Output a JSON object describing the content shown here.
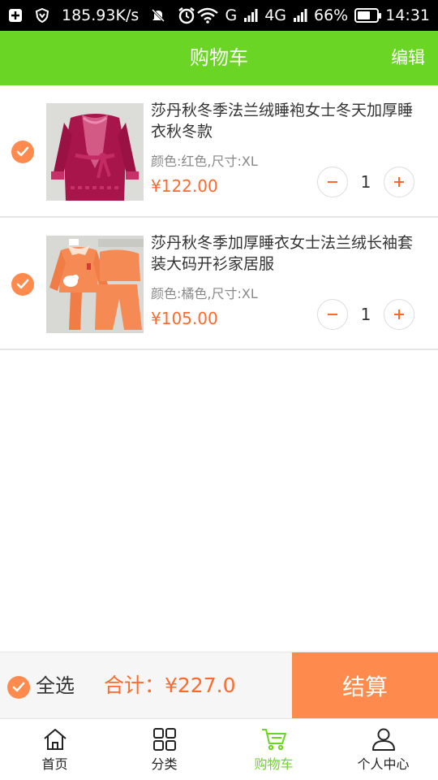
{
  "status_bar": {
    "net_speed": "185.93K/s",
    "network": "4G",
    "sim_label": "G",
    "battery_pct": "66%",
    "battery_level": 0.66,
    "time": "14:31"
  },
  "header": {
    "title": "购物车",
    "edit_label": "编辑"
  },
  "cart": {
    "items": [
      {
        "name": "莎丹秋冬季法兰绒睡袍女士冬天加厚睡衣秋冬款",
        "spec": "颜色:红色,尺寸:XL",
        "price": "¥122.00",
        "qty": "1",
        "checked": true,
        "color": "#b0194e"
      },
      {
        "name": "莎丹秋冬季加厚睡衣女士法兰绒长袖套装大码开衫家居服",
        "spec": "颜色:橘色,尺寸:XL",
        "price": "¥105.00",
        "qty": "1",
        "checked": true,
        "color": "#f58a55"
      }
    ]
  },
  "checkout": {
    "select_all_label": "全选",
    "total_label": "合计：¥227.0",
    "checkout_label": "结算"
  },
  "nav": {
    "items": [
      {
        "label": "首页",
        "icon": "home-icon"
      },
      {
        "label": "分类",
        "icon": "grid-icon"
      },
      {
        "label": "购物车",
        "icon": "cart-icon"
      },
      {
        "label": "个人中心",
        "icon": "user-icon"
      }
    ]
  },
  "colors": {
    "brand_green": "#6bd525",
    "accent_orange": "#ff8a4d",
    "price_orange": "#ff6a2c"
  }
}
